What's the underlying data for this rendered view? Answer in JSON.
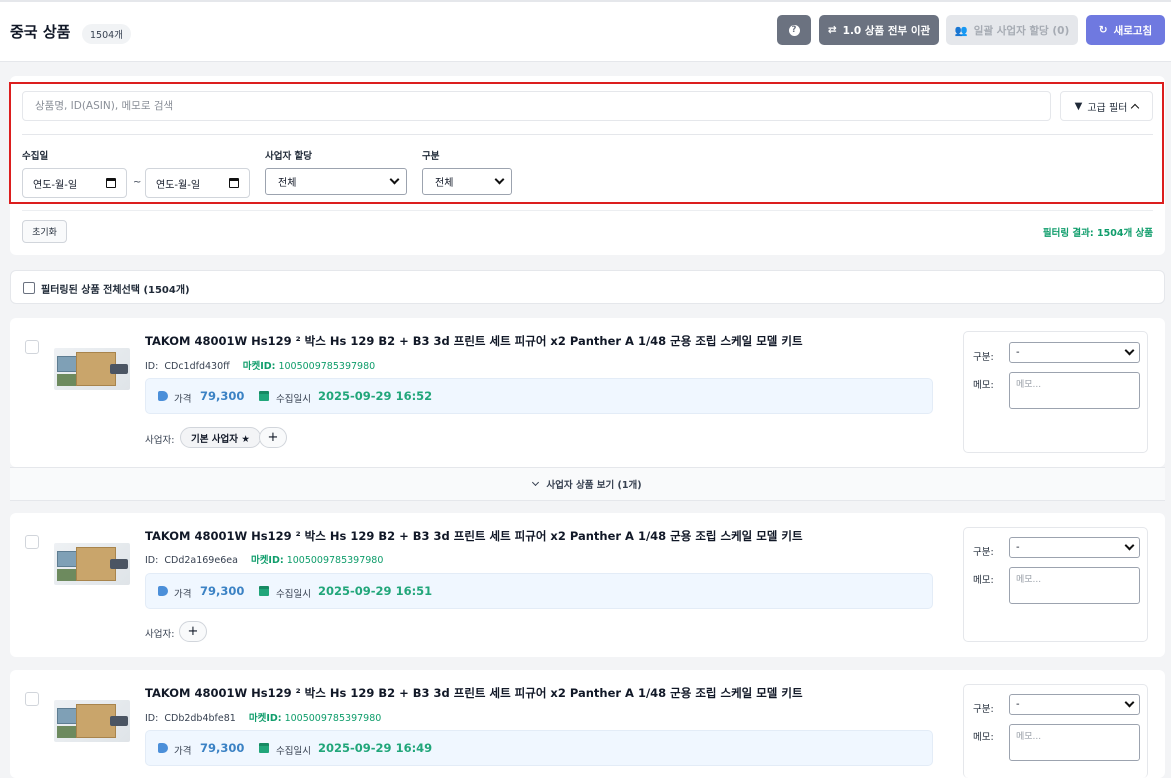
{
  "header": {
    "title": "중국 상품",
    "count_badge": "1504개",
    "help_button": "?",
    "migrate_label": "1.0 상품 전부 이관",
    "assign_label": "일괄 사업자 할당 (0)",
    "refresh_label": "새로고침"
  },
  "filters": {
    "search_placeholder": "상품명, ID(ASIN), 메모로 검색",
    "advanced_label": "고급 필터",
    "date_label": "수집일",
    "date_from": "연도-월-일",
    "date_to": "연도-월-일",
    "date_sep": "~",
    "seller_assign_label": "사업자 할당",
    "seller_assign_value": "전체",
    "category_label": "구분",
    "category_value": "전체",
    "reset_label": "초기화",
    "result_text": "필터링 결과: 1504개 상품"
  },
  "select_all": {
    "label": "필터링된 상품 전체선택 (1504개)"
  },
  "labels": {
    "id_prefix": "ID:",
    "market_prefix": "마켓ID:",
    "price_label": "가격",
    "collected_label": "수집일시",
    "seller_label": "사업자:",
    "side_category": "구분:",
    "side_memo": "메모:",
    "memo_placeholder": "메모...",
    "plus": "+",
    "expand_label": "사업자 상품 보기 (1개)"
  },
  "products": [
    {
      "title": "TAKOM 48001W Hs129 ² 박스 Hs 129 B2 + B3 3d 프린트 세트 피규어 x2 Panther A 1/48 군용 조립 스케일 모델 키트",
      "id": "CDc1dfd430ff",
      "market_id": "1005009785397980",
      "price": "79,300",
      "collected": "2025-09-29 16:52",
      "seller_chip": "기본 사업자 ★",
      "category": "-"
    },
    {
      "title": "TAKOM 48001W Hs129 ² 박스 Hs 129 B2 + B3 3d 프린트 세트 피규어 x2 Panther A 1/48 군용 조립 스케일 모델 키트",
      "id": "CDd2a169e6ea",
      "market_id": "1005009785397980",
      "price": "79,300",
      "collected": "2025-09-29 16:51",
      "category": "-"
    },
    {
      "title": "TAKOM 48001W Hs129 ² 박스 Hs 129 B2 + B3 3d 프린트 세트 피규어 x2 Panther A 1/48 군용 조립 스케일 모델 키트",
      "id": "CDb2db4bfe81",
      "market_id": "1005009785397980",
      "price": "79,300",
      "collected": "2025-09-29 16:49",
      "category": "-"
    }
  ],
  "colors": {
    "refresh_button": "#6f79e0",
    "gray_button": "#6b7280",
    "green_accent": "#0f9d6b",
    "price_blue": "#3b82c4",
    "highlight_red": "#dc1e1e"
  }
}
